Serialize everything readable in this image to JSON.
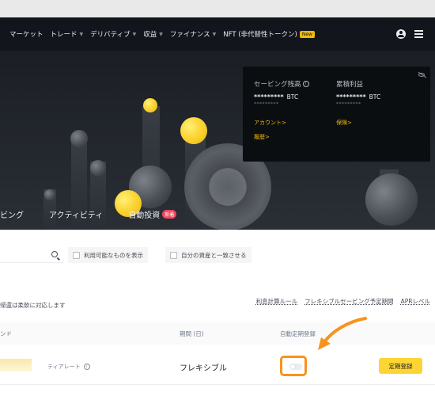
{
  "nav": {
    "items": [
      {
        "label": "マーケット",
        "caret": false
      },
      {
        "label": "トレード",
        "caret": true
      },
      {
        "label": "デリバティブ",
        "caret": true
      },
      {
        "label": "収益",
        "caret": true
      },
      {
        "label": "ファイナンス",
        "caret": true
      },
      {
        "label": "NFT (非代替性トークン)",
        "caret": false,
        "badge": "New"
      }
    ],
    "caret_glyph": "▼"
  },
  "hero": {
    "tabs": [
      {
        "label": "ビング"
      },
      {
        "label": "アクティビティ"
      },
      {
        "label": "自動投資",
        "badge": "新着"
      }
    ]
  },
  "balance": {
    "savings_label": "セービング残高",
    "savings_value": "*********",
    "savings_unit": "BTC",
    "savings_sub": "*********",
    "total_label": "累積利益",
    "total_value": "*********",
    "total_unit": "BTC",
    "total_sub": "*********",
    "account_link": "アカウント>",
    "history_link": "履歴>",
    "voucher_link": "保険>"
  },
  "filters": {
    "show_available": "利用可能なものを表示",
    "match_assets": "自分の資産と一致させる"
  },
  "notice": "帰還は柔軟に対応します",
  "links": [
    "利息計算ルール",
    "フレキシブルセービング予定期間",
    "APRレベル"
  ],
  "table": {
    "headers": {
      "coin": "ンド",
      "period": "期間 (日)",
      "auto": "自動定期登録"
    },
    "row": {
      "tier_label": "ティアレート",
      "period": "フレキシブル",
      "auto_subscribe": false,
      "button": "定期登録"
    }
  },
  "colors": {
    "accent": "#fcd535",
    "highlight": "#f7931e",
    "topbar": "#12161c"
  }
}
